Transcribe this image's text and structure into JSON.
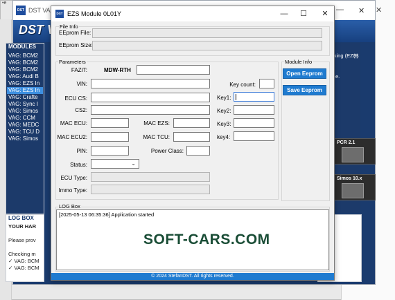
{
  "background": {
    "far_window_tag": "•e",
    "dst_app": {
      "title": "DST VAG",
      "banner_logo": "DST V",
      "modules_title": "MODULES",
      "modules": [
        "VAG: BCM2",
        "VAG: BCM2",
        "VAG: BCM2",
        "VAG: Audi B",
        "VAG: EZS In",
        "VAG: EZS In",
        "VAG: Crafte",
        "VAG: Sync I",
        "VAG: Simos",
        "VAG: CCM",
        "VAG: MEDC",
        "VAG: TCU D",
        "VAG: Simos"
      ],
      "selected_module_index": 5,
      "logbox_title": "LOG BOX",
      "logbox_lines": [
        "YOUR HAR",
        "Please prov",
        "Checking m",
        "✓ VAG: BCM",
        "✓ VAG: BCM"
      ],
      "right_text_1": "cking (EZS)",
      "right_text_2": "(S",
      "right_text_3": "e.",
      "card_1": "PCR 2.1",
      "card_2": "Simos 10.x"
    }
  },
  "dialog": {
    "title": "EZS Module 0L01Y",
    "file_info": {
      "group_title": "File Info",
      "eeprom_file_label": "EEprom File:",
      "eeprom_file_value": "",
      "eeprom_size_label": "EEprom Size:",
      "eeprom_size_value": ""
    },
    "parameters": {
      "group_title": "Parameters",
      "fazit_label": "FAZIT:",
      "fazit_prefix": "MDW-RTH",
      "fazit_value": "",
      "vin_label": "VIN:",
      "vin_value": "",
      "ecu_cs_label": "ECU CS:",
      "ecu_cs_value": "",
      "cs2_label": "CS2:",
      "cs2_value": "",
      "mac_ecu_label": "MAC ECU:",
      "mac_ecu_value": "",
      "mac_ezs_label": "MAC EZS:",
      "mac_ezs_value": "",
      "mac_ecu2_label": "MAC ECU2:",
      "mac_ecu2_value": "",
      "mac_tcu_label": "MAC TCU:",
      "mac_tcu_value": "",
      "pin_label": "PIN:",
      "pin_value": "",
      "power_class_label": "Power Class:",
      "power_class_value": "",
      "status_label": "Status:",
      "status_value": "",
      "ecu_type_label": "ECU Type:",
      "ecu_type_value": "",
      "immo_type_label": "Immo Type:",
      "immo_type_value": "",
      "key_count_label": "Key count:",
      "key_count_value": "",
      "key1_label": "Key1:",
      "key1_value": "",
      "key2_label": "Key2:",
      "key2_value": "",
      "key3_label": "Key3:",
      "key3_value": "",
      "key4_label": "key4:",
      "key4_value": ""
    },
    "module_info": {
      "group_title": "Module Info",
      "open_button": "Open Eeprom",
      "save_button": "Save Eeprom"
    },
    "log_box": {
      "group_title": "LOG Box",
      "lines": [
        "[2025-05-13 06:35:36] Application started"
      ]
    },
    "footer": "© 2024 StefanDST. All rights reserved."
  },
  "watermark": "SOFT-CARS.COM",
  "colors": {
    "accent_blue": "#1f7bd0",
    "dst_navy": "#1a3b6e",
    "selected_module": "#3d8fe0",
    "watermark": "#1a4d36"
  },
  "icons": {
    "minimize": "minimize-icon",
    "maximize": "maximize-icon",
    "close": "close-icon",
    "dropdown": "chevron-down-icon"
  }
}
